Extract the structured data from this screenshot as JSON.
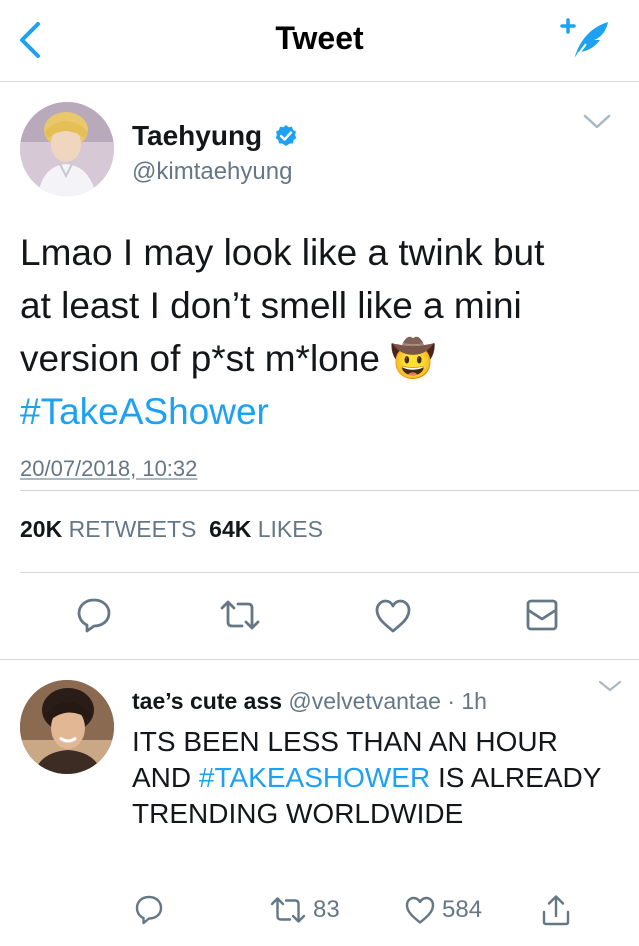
{
  "header": {
    "title": "Tweet"
  },
  "tweet": {
    "author_name": "Taehyung",
    "author_handle": "@kimtaehyung",
    "text_lines": [
      "Lmao I may look like a twink but",
      "at least I don’t smell like a mini",
      "version of p*st m*lone "
    ],
    "emoji": "🤠",
    "hashtag": "#TakeAShower",
    "timestamp": "20/07/2018, 10:32",
    "retweets_count": "20K",
    "retweets_label": "RETWEETS",
    "likes_count": "64K",
    "likes_label": "LIKES"
  },
  "reply": {
    "author_name": "tae’s cute ass",
    "author_handle": "@velvetvantae",
    "separator": "·",
    "time": "1h",
    "text_before": "ITS BEEN LESS THAN AN HOUR AND ",
    "hashtag": "#TAKEASHOWER",
    "text_after": " IS ALREADY TRENDING WORLDWIDE",
    "retweet_count": "83",
    "like_count": "584"
  },
  "colors": {
    "accent": "#1da1f2",
    "secondary_text": "#657786",
    "divider": "#d8d8d8",
    "icon": "#657786"
  },
  "icons": [
    "back-chevron",
    "compose",
    "verified-badge",
    "chevron-down",
    "reply",
    "retweet",
    "like",
    "direct-message",
    "share"
  ]
}
